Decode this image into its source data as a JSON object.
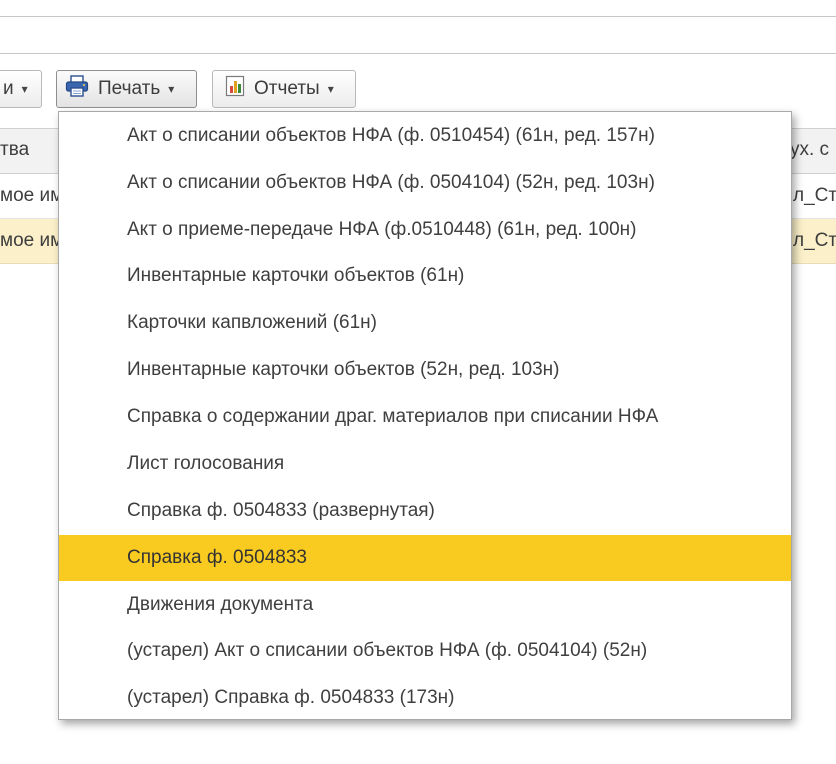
{
  "toolbar": {
    "left_button_label": "и",
    "print_button_label": "Печать",
    "reports_button_label": "Отчеты",
    "caret": "▾"
  },
  "grid": {
    "header_left": "тва",
    "header_right": "ух. с",
    "rows": [
      {
        "left": "мое им",
        "right": "л_Ст"
      },
      {
        "left": "мое им",
        "right": "л_Ст"
      }
    ]
  },
  "print_menu": {
    "items": [
      "Акт о списании объектов НФА (ф. 0510454) (61н, ред. 157н)",
      "Акт о списании объектов НФА (ф. 0504104) (52н, ред. 103н)",
      "Акт о приеме-передаче НФА (ф.0510448) (61н, ред. 100н)",
      "Инвентарные карточки объектов (61н)",
      "Карточки капвложений (61н)",
      "Инвентарные карточки объектов (52н, ред. 103н)",
      "Справка о содержании драг. материалов при списании НФА",
      "Лист голосования",
      "Справка ф. 0504833 (развернутая)",
      "Справка ф. 0504833",
      "Движения документа",
      "(устарел) Акт о списании объектов НФА (ф. 0504104) (52н)",
      "(устарел) Справка ф. 0504833 (173н)"
    ],
    "selected_item": "Справка ф. 0504833"
  },
  "colors": {
    "selected_highlight": "#f9cb21",
    "selected_row": "#fbf0c9",
    "header_background": "#f2f2f2"
  },
  "icons": {
    "print": "printer-icon",
    "reports": "report-chart-icon",
    "dropdown": "chevron-down-icon"
  }
}
